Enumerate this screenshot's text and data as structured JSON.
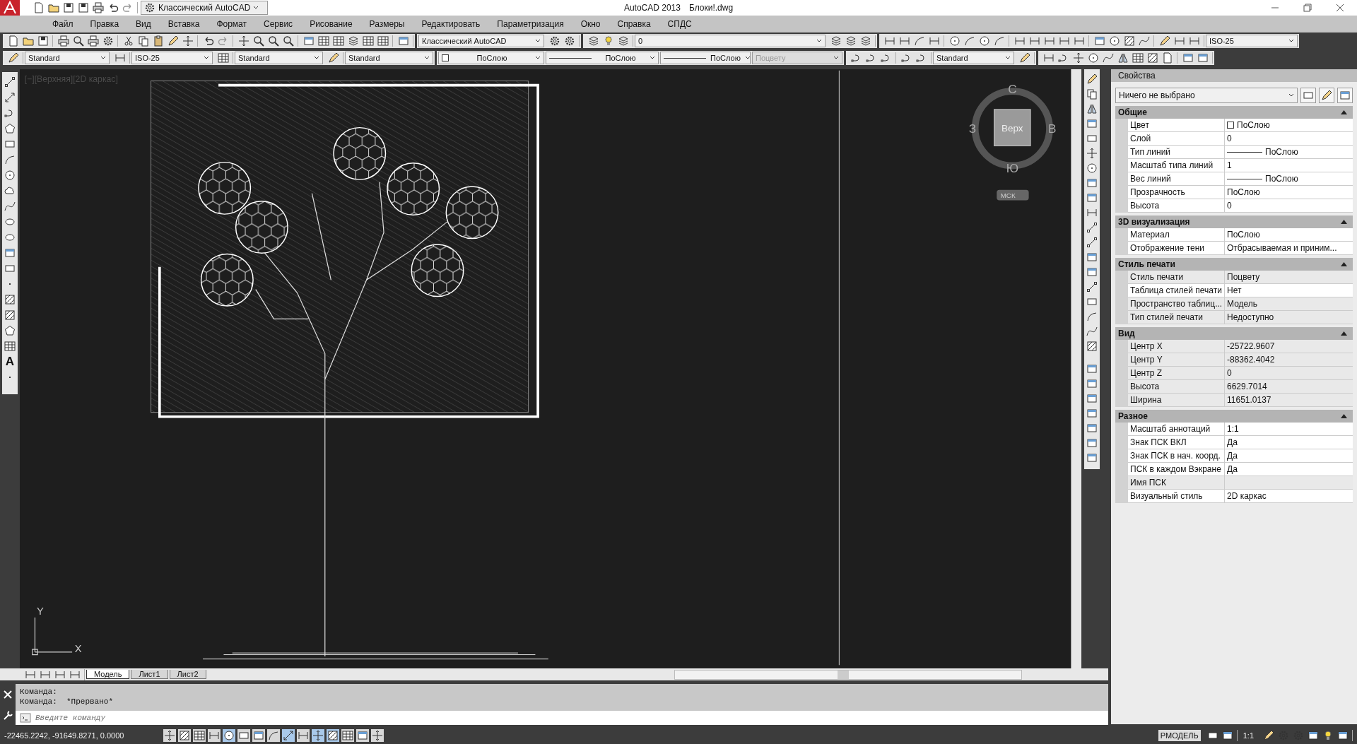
{
  "window": {
    "app": "AutoCAD 2013",
    "file": "Блоки!.dwg"
  },
  "quick_access": {
    "workspace": "Классический AutoCAD"
  },
  "menu": [
    "Файл",
    "Правка",
    "Вид",
    "Вставка",
    "Формат",
    "Сервис",
    "Рисование",
    "Размеры",
    "Редактировать",
    "Параметризация",
    "Окно",
    "Справка",
    "СПДС"
  ],
  "toolbar_1": {
    "workspace": "Классический AutoCAD",
    "layer": "0",
    "dim_style": "ISO-25"
  },
  "toolbar_2": {
    "text_style": "Standard",
    "dim_style": "ISO-25",
    "table_style": "Standard",
    "mleader_style": "Standard",
    "color_control": "ПоСлою",
    "linetype": "ПоСлою",
    "lineweight": "ПоСлою",
    "plot_style": {
      "value": "Поцвету",
      "disabled": true
    },
    "multiline_style": "Standard"
  },
  "draw_toolbar": {
    "text_tool": "A"
  },
  "viewport_label": "[−][Верхняя][2D каркас]",
  "viewcube": {
    "top": "Верх",
    "north": "С",
    "east": "В",
    "south": "Ю",
    "west": "З",
    "ucs": "МСК"
  },
  "ucs_icon": {
    "y": "Y",
    "x": "X"
  },
  "layout_tabs": [
    {
      "label": "Модель",
      "selected": true
    },
    {
      "label": "Лист1",
      "selected": false
    },
    {
      "label": "Лист2",
      "selected": false
    }
  ],
  "command_history": [
    "Команда:",
    "Команда:  *Прервано*"
  ],
  "command_line": {
    "placeholder": "Введите команду"
  },
  "status_bar": {
    "coords": "-22465.2242, -91649.8271, 0.0000",
    "space": "РМОДЕЛЬ",
    "scale": "1:1",
    "toggles": [
      {
        "on": false
      },
      {
        "on": false
      },
      {
        "on": false
      },
      {
        "on": false
      },
      {
        "on": true
      },
      {
        "on": false
      },
      {
        "on": false
      },
      {
        "on": false
      },
      {
        "on": true
      },
      {
        "on": false
      },
      {
        "on": true
      },
      {
        "on": true
      },
      {
        "on": false
      },
      {
        "on": false
      },
      {
        "on": false
      }
    ]
  },
  "properties": {
    "title": "Свойства",
    "selection": "Ничего не выбрано",
    "sections": [
      {
        "title": "Общие",
        "expanded": true,
        "rows": [
          {
            "label": "Цвет",
            "value": "ПоСлою",
            "kind": "color"
          },
          {
            "label": "Слой",
            "value": "0",
            "kind": "text"
          },
          {
            "label": "Тип линий",
            "value": "ПоСлою",
            "kind": "linetype"
          },
          {
            "label": "Масштаб типа линий",
            "value": "1",
            "kind": "text"
          },
          {
            "label": "Вес линий",
            "value": "ПоСлою",
            "kind": "linetype"
          },
          {
            "label": "Прозрачность",
            "value": "ПоСлою",
            "kind": "text"
          },
          {
            "label": "Высота",
            "value": "0",
            "kind": "text"
          }
        ]
      },
      {
        "title": "3D визуализация",
        "expanded": true,
        "rows": [
          {
            "label": "Материал",
            "value": "ПоСлою",
            "kind": "text"
          },
          {
            "label": "Отображение тени",
            "value": "Отбрасываемая и приним...",
            "kind": "text"
          }
        ]
      },
      {
        "title": "Стиль печати",
        "expanded": true,
        "rows": [
          {
            "label": "Стиль печати",
            "value": "Поцвету",
            "kind": "readonly"
          },
          {
            "label": "Таблица стилей печати",
            "value": "Нет",
            "kind": "text"
          },
          {
            "label": "Пространство таблиц...",
            "value": "Модель",
            "kind": "readonly"
          },
          {
            "label": "Тип стилей печати",
            "value": "Недоступно",
            "kind": "readonly"
          }
        ]
      },
      {
        "title": "Вид",
        "expanded": true,
        "rows": [
          {
            "label": "Центр X",
            "value": "-25722.9607",
            "kind": "readonly"
          },
          {
            "label": "Центр Y",
            "value": "-88362.4042",
            "kind": "readonly"
          },
          {
            "label": "Центр Z",
            "value": "0",
            "kind": "readonly"
          },
          {
            "label": "Высота",
            "value": "6629.7014",
            "kind": "readonly"
          },
          {
            "label": "Ширина",
            "value": "11651.0137",
            "kind": "readonly"
          }
        ]
      },
      {
        "title": "Разное",
        "expanded": true,
        "rows": [
          {
            "label": "Масштаб аннотаций",
            "value": "1:1",
            "kind": "text"
          },
          {
            "label": "Знак ПСК ВКЛ",
            "value": "Да",
            "kind": "text"
          },
          {
            "label": "Знак ПСК в нач. коорд.",
            "value": "Да",
            "kind": "text"
          },
          {
            "label": "ПСК в каждом Вэкране",
            "value": "Да",
            "kind": "text"
          },
          {
            "label": "Имя ПСК",
            "kind": "readonly"
          },
          {
            "label": "Визуальный стиль",
            "value": "2D каркас",
            "kind": "text"
          }
        ]
      }
    ]
  }
}
